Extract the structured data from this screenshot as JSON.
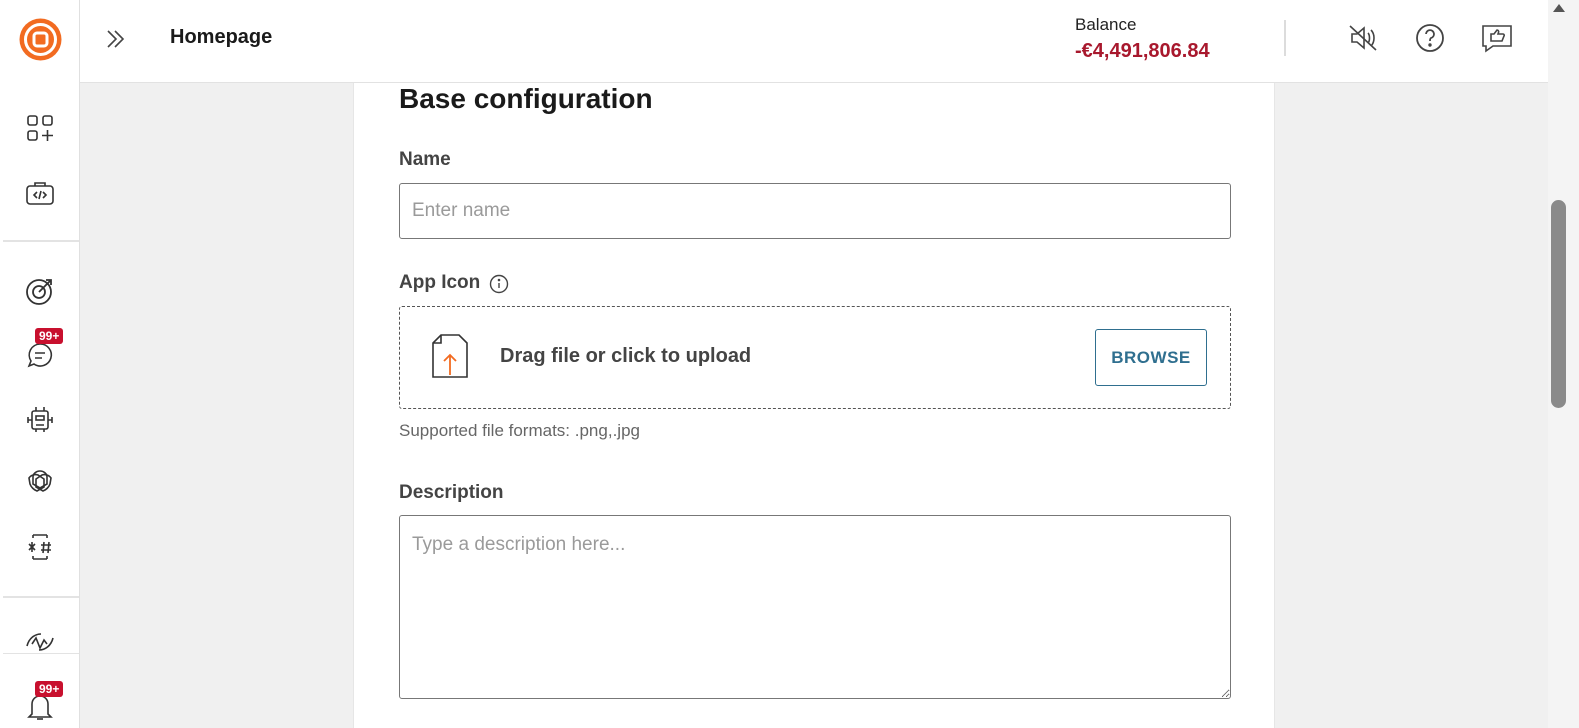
{
  "header": {
    "title": "Homepage",
    "balance_label": "Balance",
    "balance_value": "-€4,491,806.84"
  },
  "sidebar": {
    "items": [
      {
        "name": "apps-add-icon"
      },
      {
        "name": "code-briefcase-icon"
      },
      {
        "name": "target-icon"
      },
      {
        "name": "chat-icon",
        "badge": "99+"
      },
      {
        "name": "robot-icon"
      },
      {
        "name": "openai-icon"
      },
      {
        "name": "prompt-hash-icon"
      },
      {
        "name": "activity-icon"
      },
      {
        "name": "bell-icon",
        "badge": "99+"
      }
    ]
  },
  "form": {
    "section_title": "Base configuration",
    "name_label": "Name",
    "name_placeholder": "Enter name",
    "name_value": "",
    "app_icon_label": "App Icon",
    "upload_text": "Drag file or click to upload",
    "browse_label": "BROWSE",
    "supported_formats": "Supported file formats: .png,.jpg",
    "description_label": "Description",
    "description_placeholder": "Type a description here..."
  },
  "colors": {
    "brand_orange": "#f26b21",
    "balance_negative": "#a8182d",
    "badge_red": "#c8102e",
    "browse_blue": "#2f6f8f"
  }
}
